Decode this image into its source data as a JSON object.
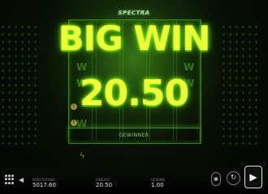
{
  "game": {
    "logo": "SPECTRA",
    "headline": "BIG WIN",
    "win_amount": "20.50",
    "winner_label": "GEWINNER"
  },
  "footer": {
    "balance_label": "KONTOSTAND",
    "balance_value": "5017.60",
    "bet_label": "EINSATZ",
    "bet_value": "20.50",
    "win_label": "GEWINN",
    "win_value": "1.00"
  },
  "icons": {
    "menu": "menu-grid-icon",
    "sound": "speaker-icon",
    "autoplay": "autoplay-icon",
    "turbo": "turbo-icon",
    "spin": "spin-play-icon"
  },
  "colors": {
    "accent": "#eaff3a",
    "glow": "#58d010",
    "background": "#050805"
  }
}
